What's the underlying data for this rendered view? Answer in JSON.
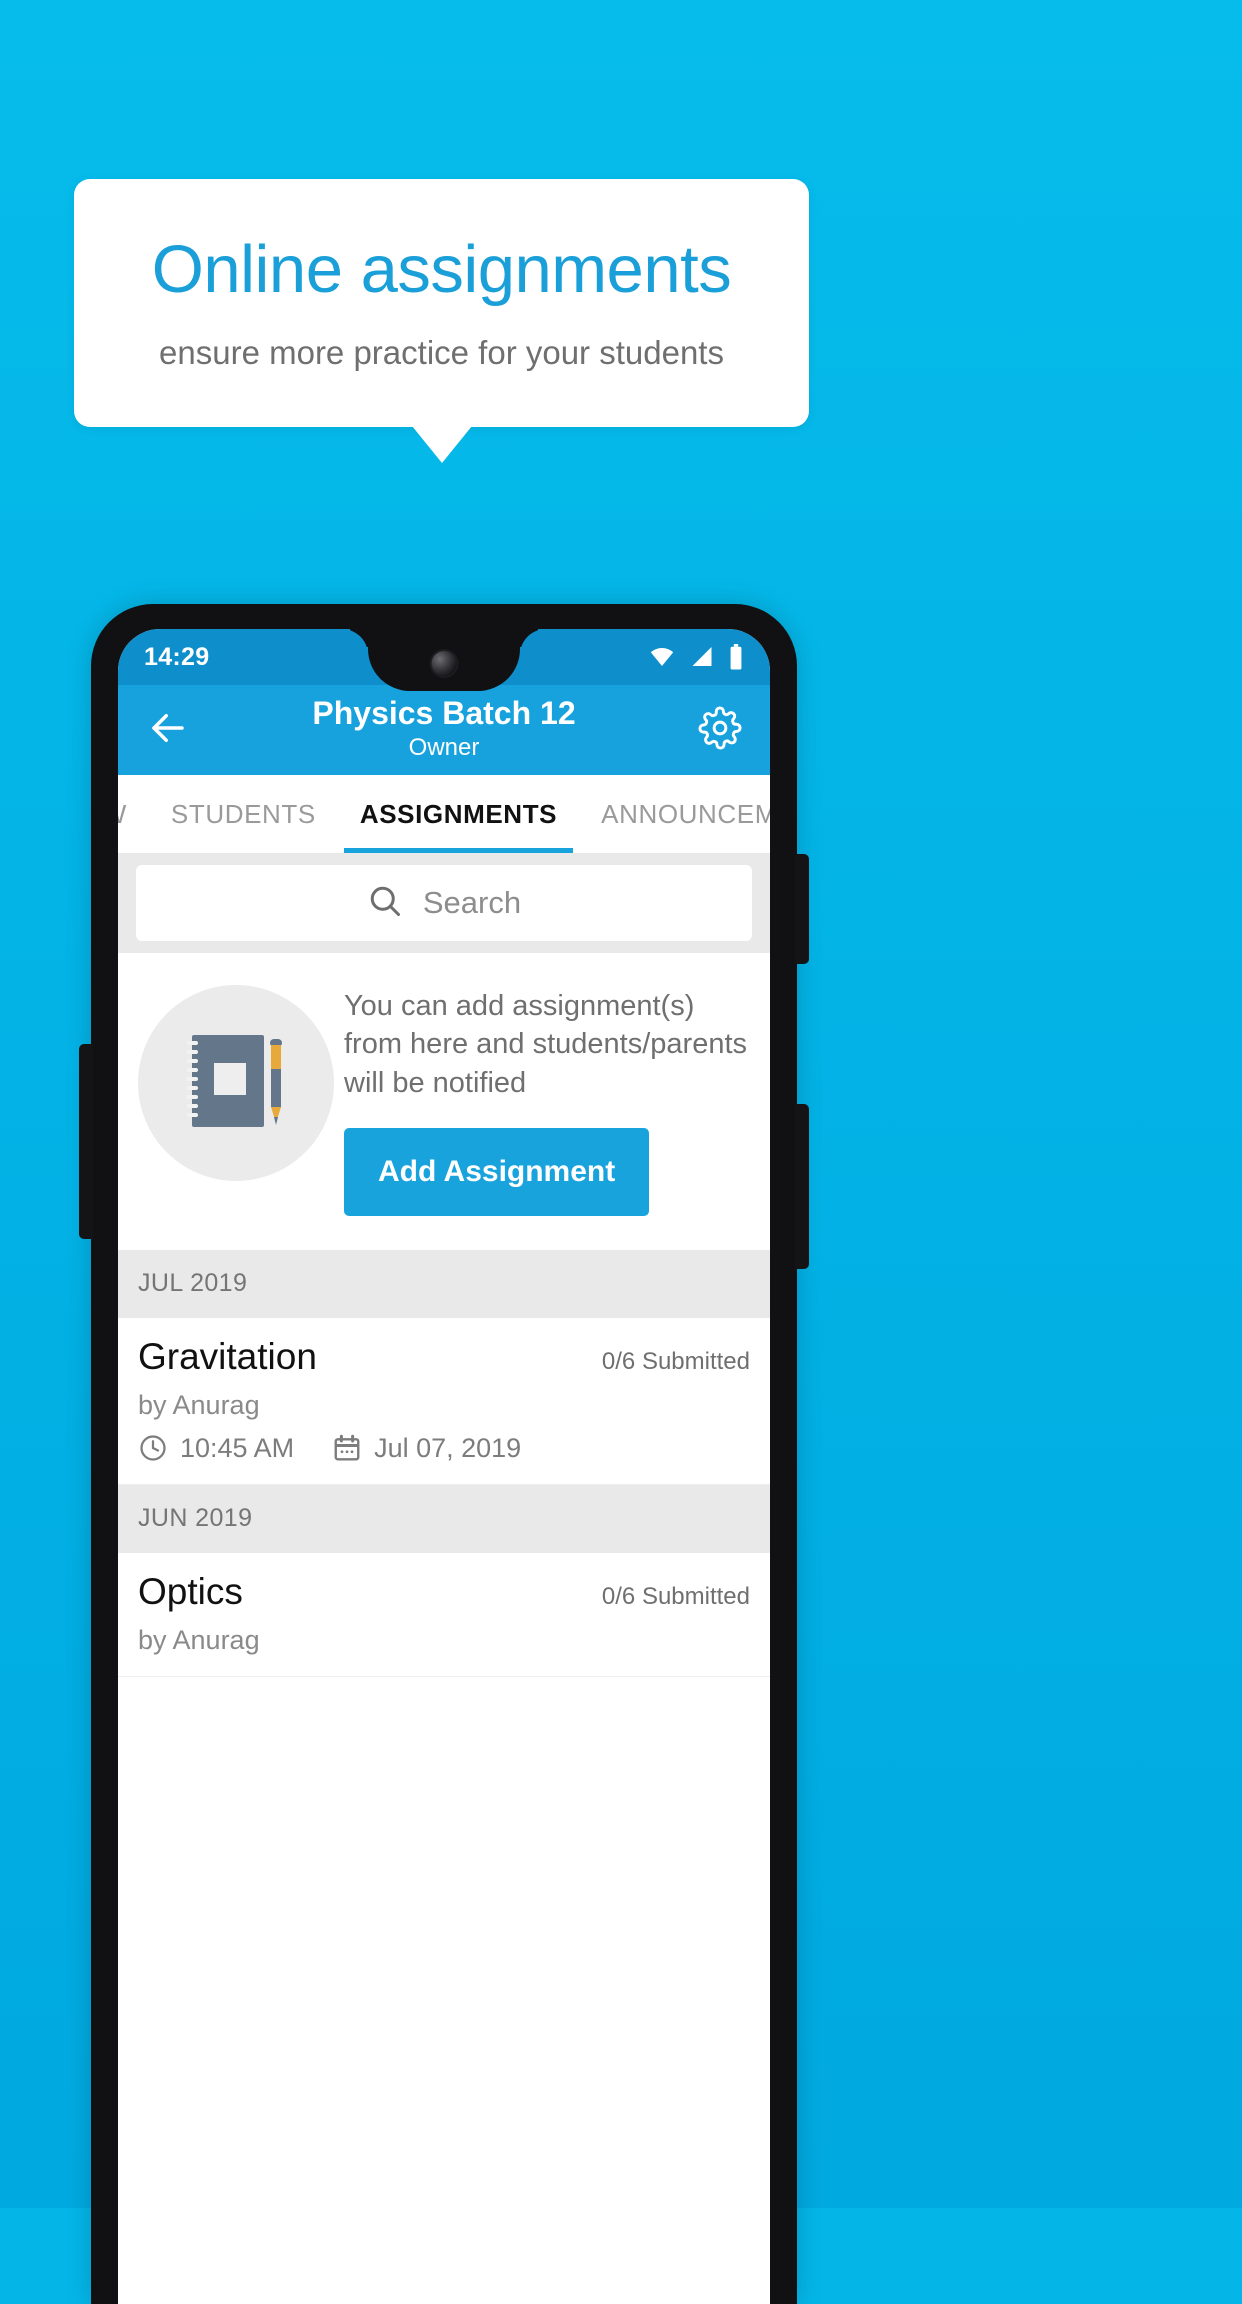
{
  "promo": {
    "title": "Online assignments",
    "subtitle": "ensure more practice for your students",
    "title_color": "#1a9fd9",
    "background_color": "#04b6e8"
  },
  "status_bar": {
    "time": "14:29",
    "icons": [
      "wifi-icon",
      "signal-icon",
      "battery-icon"
    ]
  },
  "app_bar": {
    "back_icon": "back-arrow-icon",
    "title": "Physics Batch 12",
    "subtitle": "Owner",
    "settings_icon": "gear-icon",
    "color": "#17a2dd"
  },
  "tabs": [
    {
      "label": "IEW",
      "active": false
    },
    {
      "label": "STUDENTS",
      "active": false
    },
    {
      "label": "ASSIGNMENTS",
      "active": true
    },
    {
      "label": "ANNOUNCEM",
      "active": false
    }
  ],
  "search": {
    "icon": "search-icon",
    "placeholder": "Search",
    "value": ""
  },
  "empty_state": {
    "illustration": "notebook-and-pen-icon",
    "message": "You can add assignment(s) from here and students/parents will be notified",
    "button_label": "Add Assignment",
    "button_color": "#19a3dd"
  },
  "sections": [
    {
      "month": "JUL 2019",
      "items": [
        {
          "name": "Gravitation",
          "submitted": "0/6 Submitted",
          "author": "by Anurag",
          "time": "10:45 AM",
          "date": "Jul 07, 2019"
        }
      ]
    },
    {
      "month": "JUN 2019",
      "items": [
        {
          "name": "Optics",
          "submitted": "0/6 Submitted",
          "author": "by Anurag",
          "time": "",
          "date": ""
        }
      ]
    }
  ]
}
